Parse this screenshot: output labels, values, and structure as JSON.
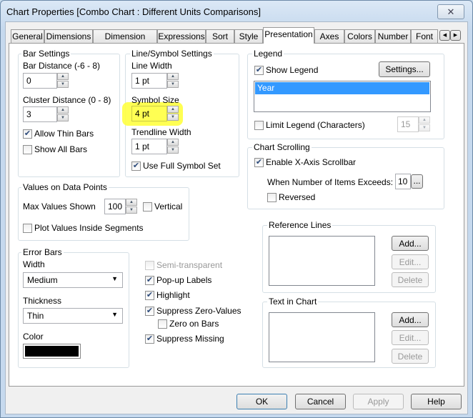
{
  "window": {
    "title": "Chart Properties [Combo Chart : Different Units Comparisons]",
    "close_icon": "close-icon"
  },
  "tabs": [
    "General",
    "Dimensions",
    "Dimension Limits",
    "Expressions",
    "Sort",
    "Style",
    "Presentation",
    "Axes",
    "Colors",
    "Number",
    "Font"
  ],
  "active_tab": "Presentation",
  "bar_settings": {
    "title": "Bar Settings",
    "bar_distance_label": "Bar Distance (-6 - 8)",
    "bar_distance": "0",
    "cluster_distance_label": "Cluster Distance (0 - 8)",
    "cluster_distance": "3",
    "allow_thin_bars": "Allow Thin Bars",
    "show_all_bars": "Show All Bars"
  },
  "line_symbol": {
    "title": "Line/Symbol Settings",
    "line_width_label": "Line Width",
    "line_width": "1 pt",
    "symbol_size_label": "Symbol Size",
    "symbol_size": "4 pt",
    "trendline_width_label": "Trendline Width",
    "trendline_width": "1 pt",
    "use_full_symbol_set": "Use Full Symbol Set",
    "highlight_color": "#ffff40"
  },
  "legend": {
    "title": "Legend",
    "show_legend": "Show Legend",
    "settings": "Settings...",
    "items": [
      "Year"
    ],
    "limit_legend": "Limit Legend (Characters)",
    "limit_value": "15"
  },
  "chart_scrolling": {
    "title": "Chart Scrolling",
    "enable": "Enable X-Axis Scrollbar",
    "exceeds_label": "When Number of Items Exceeds:",
    "exceeds_value": "10",
    "more": "...",
    "reversed": "Reversed"
  },
  "values_on_points": {
    "title": "Values on Data Points",
    "max_label": "Max Values Shown",
    "max_value": "100",
    "vertical": "Vertical",
    "plot_inside": "Plot Values Inside Segments"
  },
  "error_bars": {
    "title": "Error Bars",
    "width_label": "Width",
    "width_value": "Medium",
    "thickness_label": "Thickness",
    "thickness_value": "Thin",
    "color_label": "Color",
    "color": "#000000"
  },
  "options": {
    "semi_transparent": "Semi-transparent",
    "popup_labels": "Pop-up Labels",
    "highlight": "Highlight",
    "suppress_zero": "Suppress Zero-Values",
    "zero_on_bars": "Zero on Bars",
    "suppress_missing": "Suppress Missing"
  },
  "reference_lines": {
    "title": "Reference Lines",
    "add": "Add...",
    "edit": "Edit...",
    "delete": "Delete"
  },
  "text_in_chart": {
    "title": "Text in Chart",
    "add": "Add...",
    "edit": "Edit...",
    "delete": "Delete"
  },
  "footer": {
    "ok": "OK",
    "cancel": "Cancel",
    "apply": "Apply",
    "help": "Help"
  },
  "check": "✔"
}
